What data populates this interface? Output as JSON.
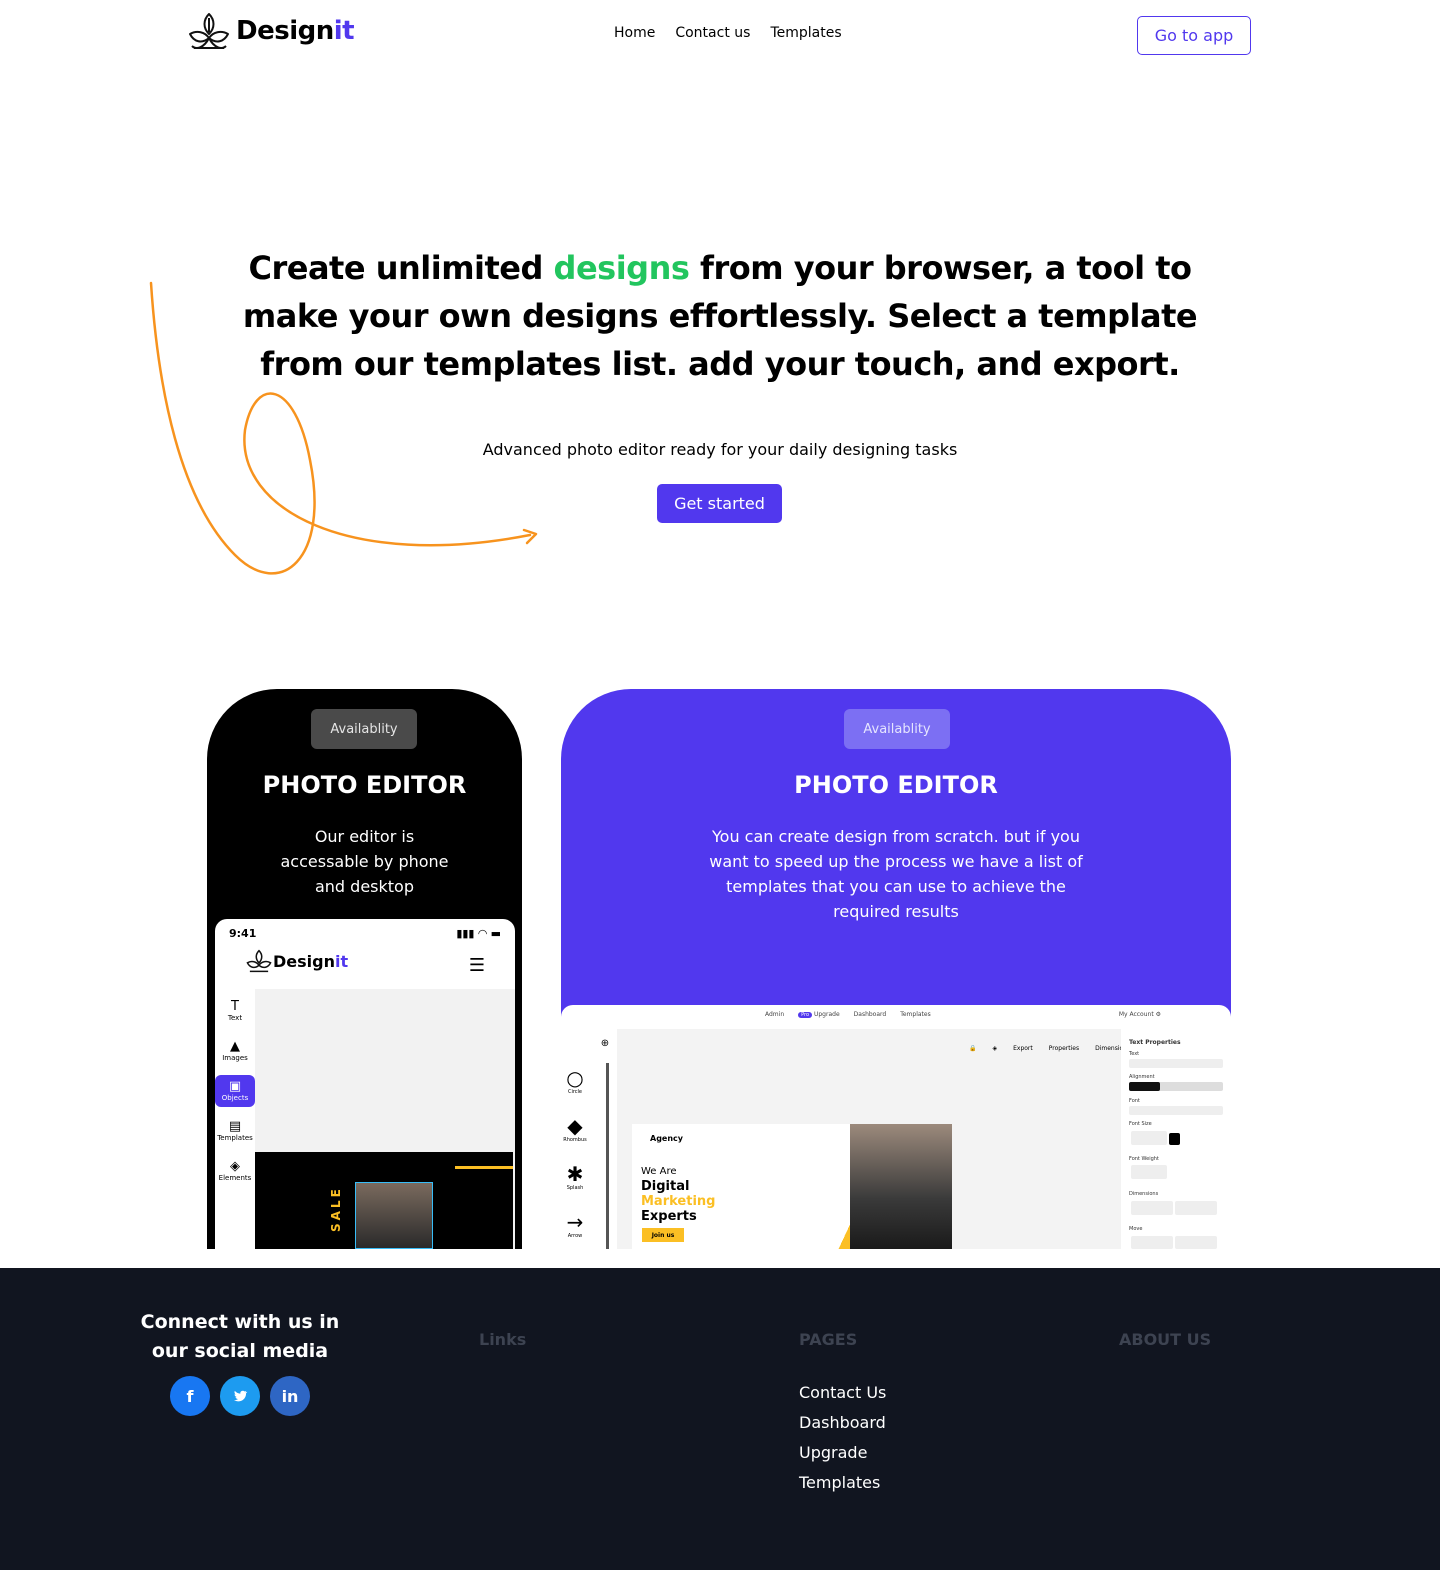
{
  "nav": {
    "logo_text_main": "Design",
    "logo_text_accent": "it",
    "links": [
      "Home",
      "Contact us",
      "Templates"
    ],
    "cta": "Go to app"
  },
  "hero": {
    "title_part1": "Create unlimited ",
    "title_highlight": "designs",
    "title_part2": " from your browser, a tool to make your own designs effortlessly. Select a template from our templates list. add your touch, and export.",
    "subtitle": "Advanced photo editor ready for your daily designing tasks",
    "button": "Get started"
  },
  "cards": [
    {
      "badge": "Availablity",
      "title": "PHOTO EDITOR",
      "description": "Our editor is accessable by phone and desktop"
    },
    {
      "badge": "Availablity",
      "title": "PHOTO EDITOR",
      "description": "You can create design from scratch. but if you want to speed up the process we have a list of templates that you can use to achieve the required results"
    }
  ],
  "phone_mock": {
    "time": "9:41",
    "logo_main": "Design",
    "logo_accent": "it",
    "tools": [
      "Text",
      "Images",
      "Objects",
      "Templates",
      "Elements"
    ],
    "poster_text": "SALE"
  },
  "desktop_mock": {
    "nav": [
      "Admin",
      "Upgrade",
      "Dashboard",
      "Templates"
    ],
    "badge": "Pro",
    "account": "My Account",
    "shapes": [
      "Circle",
      "Rhombus",
      "Splash",
      "Arrow"
    ],
    "toolbar": [
      "Export",
      "Properties",
      "Dimensions"
    ],
    "design_agency": "Agency",
    "design_line1": "We Are",
    "design_line2": "Digital",
    "design_line3": "Marketing",
    "design_line4": "Experts",
    "design_button": "Join us",
    "props_title": "Text Properties",
    "props": [
      "Text",
      "Alignment",
      "Font",
      "Font Size",
      "Font Weight",
      "Dimensions",
      "Move"
    ]
  },
  "footer": {
    "connect": "Connect with us in our social media",
    "socials": [
      "facebook-icon",
      "twitter-icon",
      "linkedin-icon"
    ],
    "col_links": "Links",
    "col_pages": "PAGES",
    "col_about": "ABOUT US",
    "pages": [
      "Contact Us",
      "Dashboard",
      "Upgrade",
      "Templates"
    ]
  },
  "colors": {
    "brand": "#5138ee",
    "highlight": "#22c55e",
    "squiggle": "#f7931e",
    "footer_bg": "#111520"
  }
}
